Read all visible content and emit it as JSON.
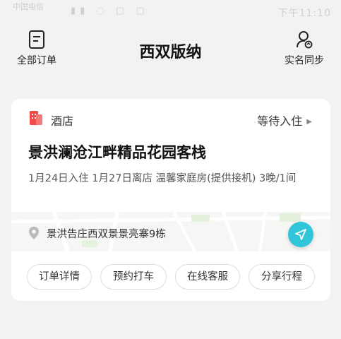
{
  "status_bar": {
    "left_text": "中国电信",
    "time": "下午11:10"
  },
  "header": {
    "left_label": "全部订单",
    "title": "西双版纳",
    "right_label": "实名同步"
  },
  "card": {
    "type_label": "酒店",
    "status": "等待入住",
    "hotel_name": "景洪澜沧江畔精品花园客栈",
    "stay_info": "1月24日入住  1月27日离店  温馨家庭房(提供接机)  3晚/1间",
    "address": "景洪告庄西双景景亮寨9栋",
    "actions": [
      "订单详情",
      "预约打车",
      "在线客服",
      "分享行程"
    ]
  },
  "colors": {
    "accent": "#2ec6d8",
    "hotel_icon": "#f04a4a"
  }
}
